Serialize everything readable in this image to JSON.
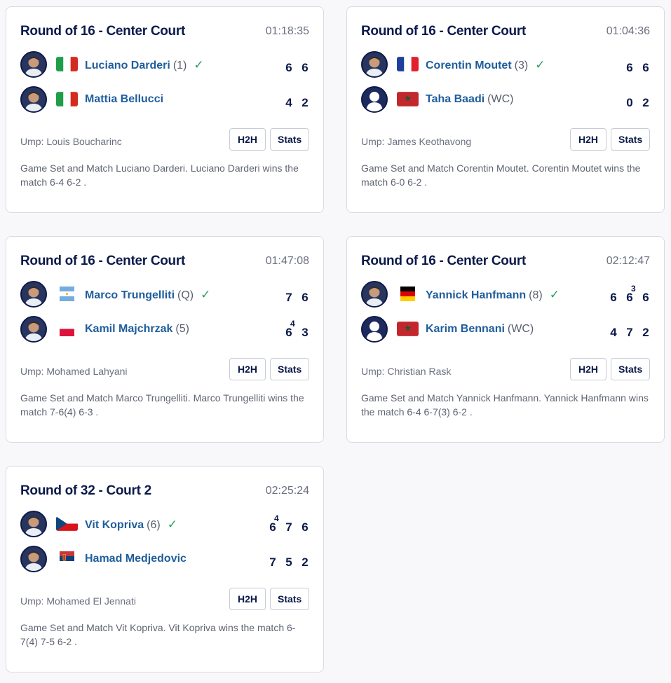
{
  "matches": [
    {
      "round": "Round of 16 - Center Court",
      "time": "01:18:35",
      "players": [
        {
          "name": "Luciano Darderi",
          "seed": "(1)",
          "winner": true,
          "flag": "italy",
          "avatar": "photo",
          "sets": [
            {
              "v": "6",
              "tb": ""
            },
            {
              "v": "6",
              "tb": ""
            }
          ]
        },
        {
          "name": "Mattia Bellucci",
          "seed": "",
          "winner": false,
          "flag": "italy",
          "avatar": "photo",
          "sets": [
            {
              "v": "4",
              "tb": ""
            },
            {
              "v": "2",
              "tb": ""
            }
          ]
        }
      ],
      "umpire": "Ump: Louis Boucharinc",
      "h2h": "H2H",
      "stats": "Stats",
      "summary": "Game Set and Match Luciano Darderi. Luciano Darderi wins the match 6-4 6-2 ."
    },
    {
      "round": "Round of 16 - Center Court",
      "time": "01:04:36",
      "players": [
        {
          "name": "Corentin Moutet",
          "seed": "(3)",
          "winner": true,
          "flag": "france",
          "avatar": "photo",
          "sets": [
            {
              "v": "6",
              "tb": ""
            },
            {
              "v": "6",
              "tb": ""
            }
          ]
        },
        {
          "name": "Taha Baadi",
          "seed": "(WC)",
          "winner": false,
          "flag": "morocco",
          "avatar": "placeholder",
          "sets": [
            {
              "v": "0",
              "tb": ""
            },
            {
              "v": "2",
              "tb": ""
            }
          ]
        }
      ],
      "umpire": "Ump: James Keothavong",
      "h2h": "H2H",
      "stats": "Stats",
      "summary": "Game Set and Match Corentin Moutet. Corentin Moutet wins the match 6-0 6-2 ."
    },
    {
      "round": "Round of 16 - Center Court",
      "time": "01:47:08",
      "players": [
        {
          "name": "Marco Trungelliti",
          "seed": "(Q)",
          "winner": true,
          "flag": "argentina",
          "avatar": "photo",
          "sets": [
            {
              "v": "7",
              "tb": ""
            },
            {
              "v": "6",
              "tb": ""
            }
          ]
        },
        {
          "name": "Kamil Majchrzak",
          "seed": "(5)",
          "winner": false,
          "flag": "poland",
          "avatar": "photo",
          "sets": [
            {
              "v": "6",
              "tb": "4"
            },
            {
              "v": "3",
              "tb": ""
            }
          ]
        }
      ],
      "umpire": "Ump: Mohamed Lahyani",
      "h2h": "H2H",
      "stats": "Stats",
      "summary": "Game Set and Match Marco Trungelliti. Marco Trungelliti wins the match 7-6(4) 6-3 ."
    },
    {
      "round": "Round of 16 - Center Court",
      "time": "02:12:47",
      "players": [
        {
          "name": "Yannick Hanfmann",
          "seed": "(8)",
          "winner": true,
          "flag": "germany",
          "avatar": "photo",
          "sets": [
            {
              "v": "6",
              "tb": ""
            },
            {
              "v": "6",
              "tb": "3"
            },
            {
              "v": "6",
              "tb": ""
            }
          ]
        },
        {
          "name": "Karim Bennani",
          "seed": "(WC)",
          "winner": false,
          "flag": "morocco",
          "avatar": "placeholder",
          "sets": [
            {
              "v": "4",
              "tb": ""
            },
            {
              "v": "7",
              "tb": ""
            },
            {
              "v": "2",
              "tb": ""
            }
          ]
        }
      ],
      "umpire": "Ump: Christian Rask",
      "h2h": "H2H",
      "stats": "Stats",
      "summary": "Game Set and Match Yannick Hanfmann. Yannick Hanfmann wins the match 6-4 6-7(3) 6-2 ."
    },
    {
      "round": "Round of 32 - Court 2",
      "time": "02:25:24",
      "players": [
        {
          "name": "Vit Kopriva",
          "seed": "(6)",
          "winner": true,
          "flag": "czechia",
          "avatar": "photo",
          "sets": [
            {
              "v": "6",
              "tb": "4"
            },
            {
              "v": "7",
              "tb": ""
            },
            {
              "v": "6",
              "tb": ""
            }
          ]
        },
        {
          "name": "Hamad Medjedovic",
          "seed": "",
          "winner": false,
          "flag": "serbia",
          "avatar": "photo",
          "sets": [
            {
              "v": "7",
              "tb": ""
            },
            {
              "v": "5",
              "tb": ""
            },
            {
              "v": "2",
              "tb": ""
            }
          ]
        }
      ],
      "umpire": "Ump: Mohamed El Jennati",
      "h2h": "H2H",
      "stats": "Stats",
      "summary": "Game Set and Match Vit Kopriva. Vit Kopriva wins the match 6-7(4) 7-5 6-2 ."
    }
  ],
  "winner_icon": "checkmark-icon",
  "colors": {
    "title": "#0b1a4a",
    "player_link": "#1f5e9c",
    "winner_check": "#2a9d5a",
    "muted": "#6b7080"
  }
}
